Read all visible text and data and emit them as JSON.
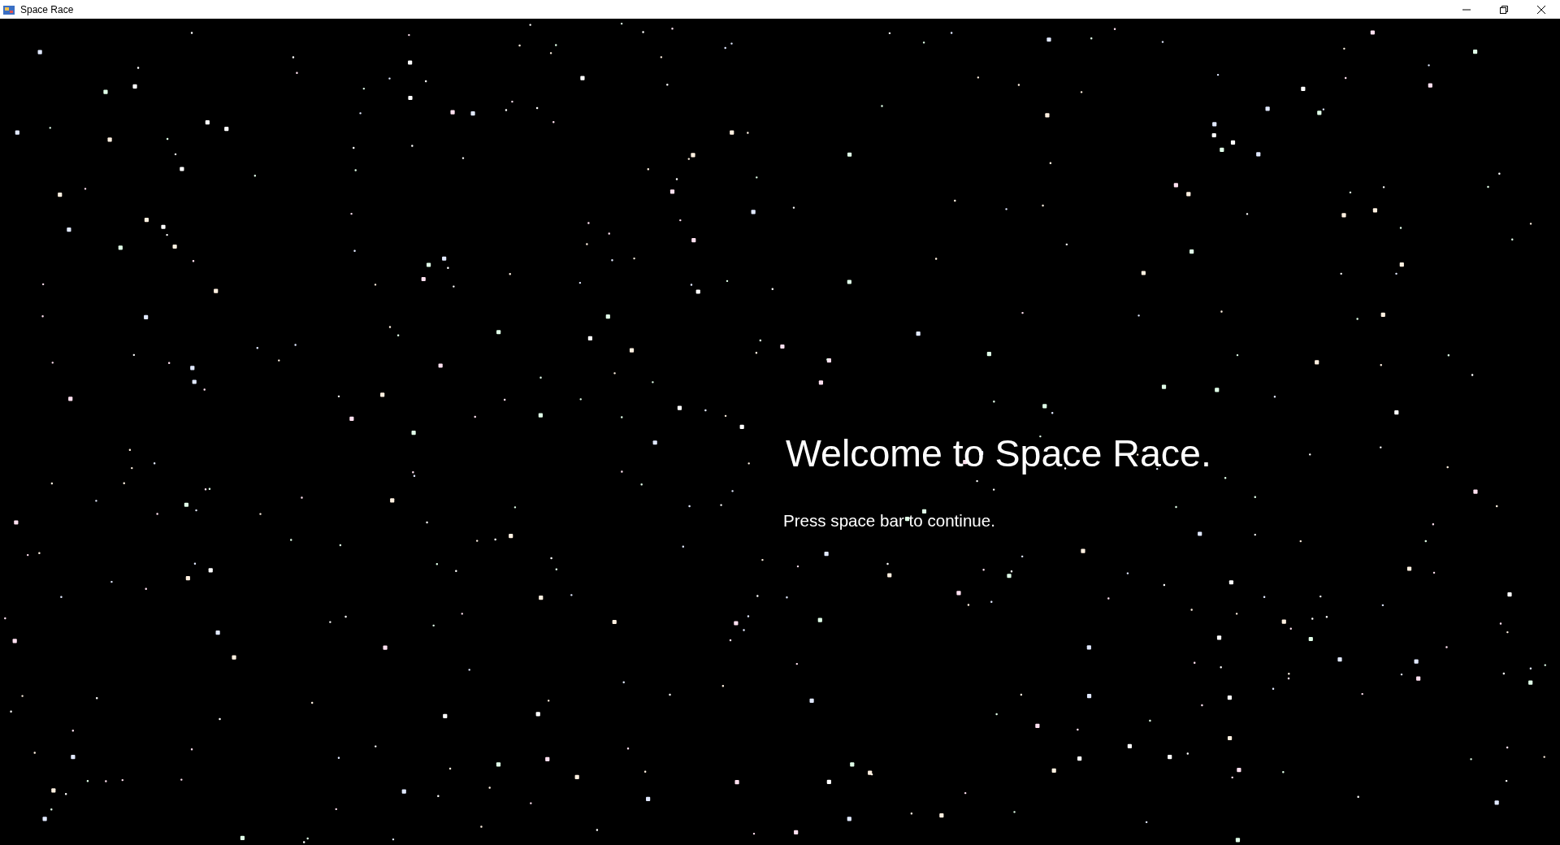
{
  "window": {
    "title": "Space Race"
  },
  "game": {
    "heading": "Welcome to Space Race.",
    "prompt": "Press space bar to continue."
  }
}
